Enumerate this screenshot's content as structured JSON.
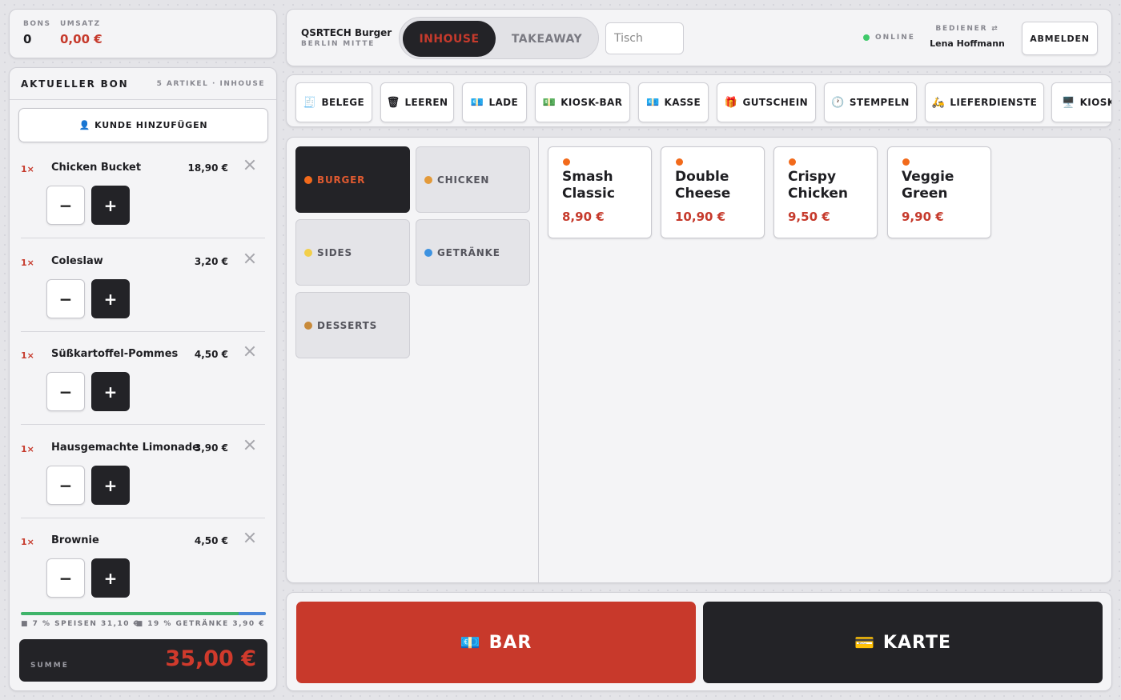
{
  "stats": {
    "bons_label": "BONS",
    "bons_value": "0",
    "umsatz_label": "UMSATZ",
    "umsatz_value": "0,00 €"
  },
  "header": {
    "store_name": "QSRTECH Burger",
    "store_location": "BERLIN MITTE",
    "mode_active": "INHOUSE",
    "mode_inactive": "TAKEAWAY",
    "table_placeholder": "Tisch",
    "status": "ONLINE",
    "operator_label": "BEDIENER ⇄",
    "operator_name": "Lena Hoffmann",
    "logout_label": "ABMELDEN"
  },
  "nav": {
    "items": [
      {
        "icon": "🧾",
        "icon_name": "receipt-icon",
        "label": "BELEGE"
      },
      {
        "icon": "🗑",
        "icon_name": "trash-icon",
        "label": "LEEREN"
      },
      {
        "icon": "💶",
        "icon_name": "cash-drawer-icon",
        "label": "LADE"
      },
      {
        "icon": "💵",
        "icon_name": "banknote-icon",
        "label": "KIOSK-BAR"
      },
      {
        "icon": "💶",
        "icon_name": "register-icon",
        "label": "KASSE"
      },
      {
        "icon": "🎁",
        "icon_name": "gift-icon",
        "label": "GUTSCHEIN"
      },
      {
        "icon": "🕐",
        "icon_name": "clock-icon",
        "label": "STEMPELN"
      },
      {
        "icon": "🛵",
        "icon_name": "scooter-icon",
        "label": "LIEFERDIENSTE"
      },
      {
        "icon": "🖥️",
        "icon_name": "monitor-icon",
        "label": "KIOSK"
      }
    ]
  },
  "receipt": {
    "title": "AKTUELLER BON",
    "meta": "5 ARTIKEL · INHOUSE",
    "add_customer_icon": "👤",
    "add_customer_label": "KUNDE HINZUFÜGEN",
    "items": [
      {
        "qty": "1×",
        "name": "Chicken Bucket",
        "price": "18,90 €"
      },
      {
        "qty": "1×",
        "name": "Coleslaw",
        "price": "3,20 €"
      },
      {
        "qty": "1×",
        "name": "Süßkartoffel-Pommes",
        "price": "4,50 €"
      },
      {
        "qty": "1×",
        "name": "Hausgemachte Limonade",
        "price": "3,90 €"
      },
      {
        "qty": "1×",
        "name": "Brownie",
        "price": "4,50 €"
      }
    ],
    "minus_label": "−",
    "plus_label": "+",
    "tax_food_label": "■ 7 % SPEISEN 31,10 €",
    "tax_drinks_label": "■ 19 % GETRÄNKE 3,90 €",
    "tax_drinks_share": 0.111,
    "tax_food_color": "#3fb46a",
    "tax_drinks_color": "#4a86d8",
    "sum_label": "SUMME",
    "sum_value": "35,00 €"
  },
  "categories": [
    {
      "label": "BURGER",
      "dot_color": "#f26a1b",
      "active": true
    },
    {
      "label": "CHICKEN",
      "dot_color": "#e39a3a",
      "active": false
    },
    {
      "label": "SIDES",
      "dot_color": "#f2cf4a",
      "active": false
    },
    {
      "label": "GETRÄNKE",
      "dot_color": "#3d92e0",
      "active": false
    },
    {
      "label": "DESSERTS",
      "dot_color": "#c88a3a",
      "active": false
    }
  ],
  "products": [
    {
      "name": "Smash Classic",
      "price": "8,90 €"
    },
    {
      "name": "Double Cheese",
      "price": "10,90 €"
    },
    {
      "name": "Crispy Chicken",
      "price": "9,50 €"
    },
    {
      "name": "Veggie Green",
      "price": "9,90 €"
    }
  ],
  "payment": {
    "cash_icon": "💶",
    "cash_label": "BAR",
    "card_icon": "💳",
    "card_label": "KARTE"
  },
  "colors": {
    "accent_red": "#c8392b",
    "dark": "#232327",
    "online_green": "#3fc96a"
  }
}
